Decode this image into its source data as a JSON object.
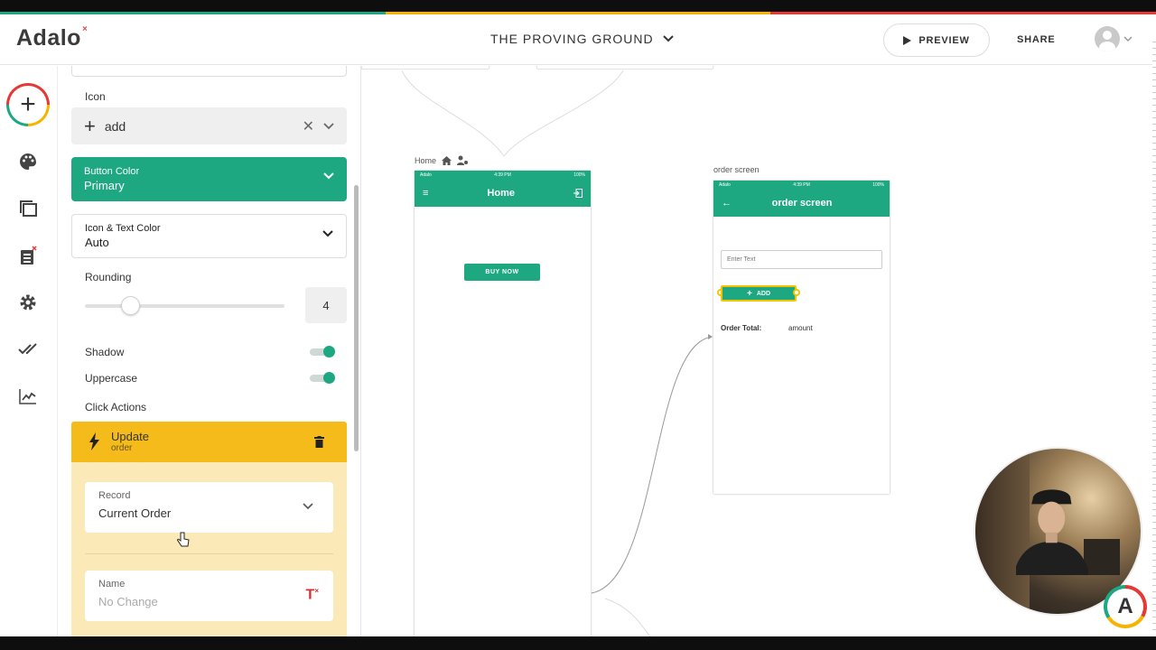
{
  "header": {
    "logo": "Adalo",
    "logo_mark": "×",
    "app_title": "THE PROVING GROUND",
    "preview_label": "PREVIEW",
    "share_label": "SHARE"
  },
  "colors": {
    "brand_green": "#1da882",
    "action_yellow": "#f4bb1a",
    "stripe": [
      "#1da882",
      "#f4b400",
      "#e53935"
    ]
  },
  "rail": {
    "icons": [
      "add-icon",
      "palette-icon",
      "screens-icon",
      "database-icon",
      "settings-icon",
      "publish-icon",
      "analytics-icon"
    ]
  },
  "panel": {
    "icon_label": "Icon",
    "icon_value": "add",
    "button_color_label": "Button Color",
    "button_color_value": "Primary",
    "icon_text_color_label": "Icon & Text Color",
    "icon_text_color_value": "Auto",
    "rounding_label": "Rounding",
    "rounding_value": "4",
    "rounding_level": 0.18,
    "shadow_label": "Shadow",
    "shadow_on": true,
    "uppercase_label": "Uppercase",
    "uppercase_on": true,
    "click_actions_label": "Click Actions",
    "action": {
      "title": "Update",
      "subtitle": "order",
      "record_label": "Record",
      "record_value": "Current Order",
      "name_label": "Name",
      "name_placeholder": "No Change"
    }
  },
  "canvas": {
    "home": {
      "label": "Home",
      "carrier": "Adalo",
      "time": "4:39 PM",
      "battery": "100%",
      "title": "Home",
      "button": "BUY NOW"
    },
    "order": {
      "label": "order screen",
      "carrier": "Adalo",
      "time": "4:39 PM",
      "battery": "100%",
      "title": "order screen",
      "input_placeholder": "Enter Text",
      "add_button": "ADD",
      "total_label": "Order Total:",
      "total_value": "amount"
    }
  },
  "badge": "A"
}
